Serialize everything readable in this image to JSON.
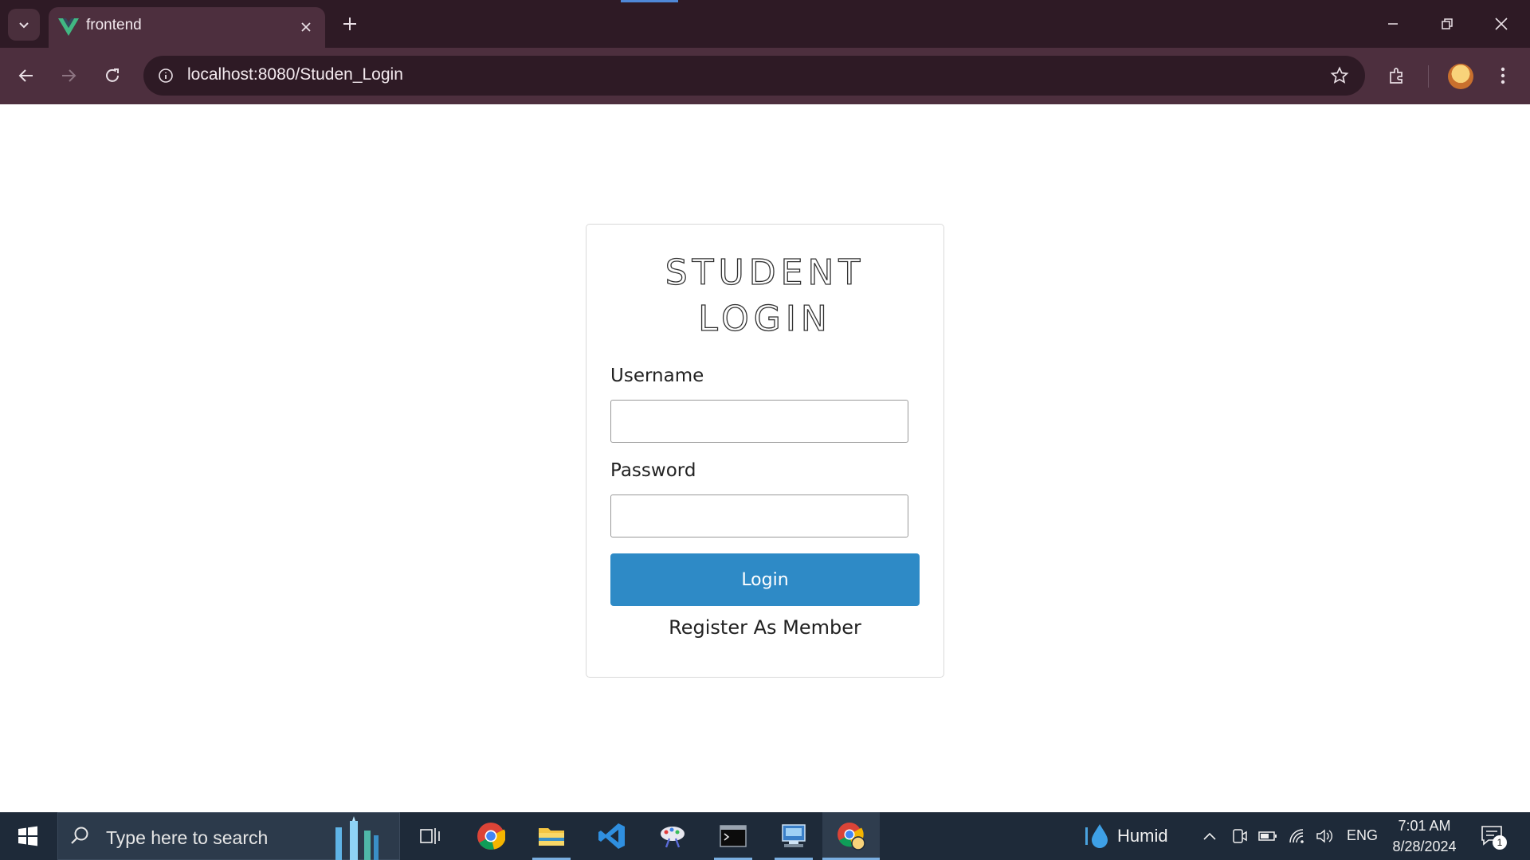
{
  "browser": {
    "tab": {
      "title": "frontend",
      "favicon": "vue-logo-icon"
    },
    "address_bar": {
      "url": "localhost:8080/Studen_Login"
    },
    "icons": [
      "tab-search-icon",
      "close-icon",
      "plus-icon",
      "minimize-icon",
      "restore-icon",
      "close-window-icon",
      "back-icon",
      "forward-icon",
      "reload-icon",
      "site-info-icon",
      "star-icon",
      "extensions-icon",
      "profile-avatar",
      "more-menu-icon"
    ]
  },
  "login_form": {
    "title_line1": "STUDENT",
    "title_line2": "LOGIN",
    "username_label": "Username",
    "username_value": "",
    "password_label": "Password",
    "password_value": "",
    "login_button": "Login",
    "register_link": "Register As Member",
    "button_color": "#2e8ac6"
  },
  "taskbar": {
    "search_placeholder": "Type here to search",
    "apps": [
      "task-view-icon",
      "chrome-icon",
      "file-explorer-icon",
      "vscode-icon",
      "paint-icon",
      "terminal-icon",
      "network-app-icon",
      "chrome-profile-icon"
    ],
    "weather": "Humid",
    "language": "ENG",
    "time": "7:01 AM",
    "date": "8/28/2024",
    "notifications": "1"
  }
}
